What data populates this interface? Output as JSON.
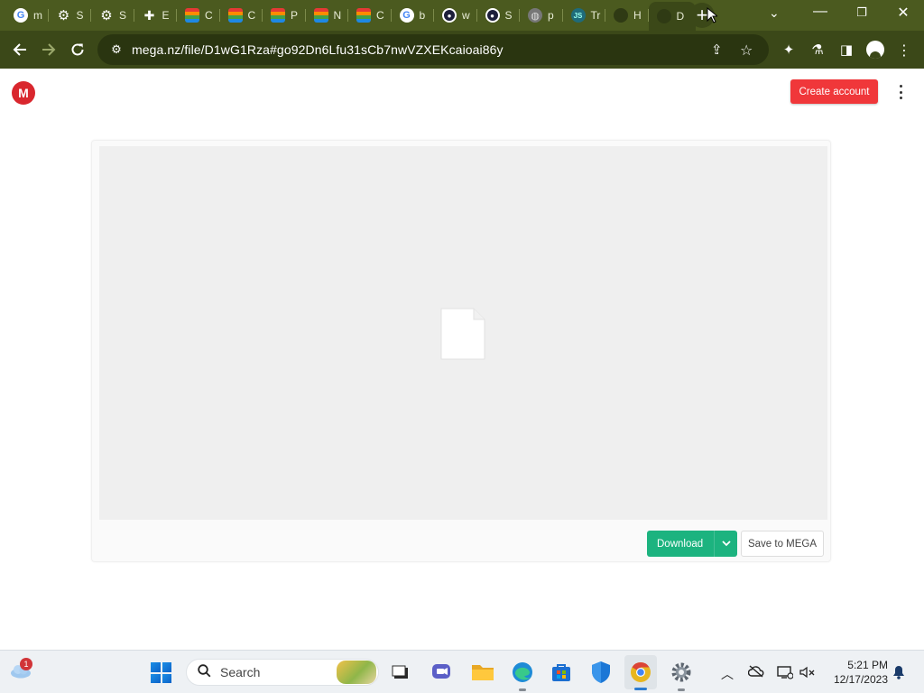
{
  "browser": {
    "tabs": [
      {
        "title": "m",
        "icon": "google-icon"
      },
      {
        "title": "S",
        "icon": "gear-icon"
      },
      {
        "title": "S",
        "icon": "gear-icon"
      },
      {
        "title": "E",
        "icon": "puzzle-icon"
      },
      {
        "title": "C",
        "icon": "rainbow-icon"
      },
      {
        "title": "C",
        "icon": "rainbow-icon"
      },
      {
        "title": "P",
        "icon": "rainbow-icon"
      },
      {
        "title": "N",
        "icon": "rainbow-icon"
      },
      {
        "title": "C",
        "icon": "rainbow-icon"
      },
      {
        "title": "b",
        "icon": "google-icon"
      },
      {
        "title": "w",
        "icon": "shield-icon"
      },
      {
        "title": "S",
        "icon": "shield-icon"
      },
      {
        "title": "p",
        "icon": "globe-icon"
      },
      {
        "title": "Tr",
        "icon": "teal-icon"
      },
      {
        "title": "H",
        "icon": "dark-icon"
      },
      {
        "title": "D",
        "icon": "dark-icon",
        "active": true
      }
    ],
    "new_tab_symbol": "+",
    "tab_close_symbol": "✕",
    "url": "mega.nz/file/D1wG1Rza#go92Dn6Lfu31sCb7nwVZXEKcaioai86y",
    "accent_color": "#3b4818"
  },
  "page": {
    "logo_letter": "M",
    "create_account_label": "Create account",
    "download_label": "Download",
    "save_label": "Save to MEGA",
    "brand_red": "#d9272e",
    "download_green": "#1cb37f"
  },
  "taskbar": {
    "notification_count": "1",
    "search_placeholder": "Search",
    "time": "5:21 PM",
    "date": "12/17/2023"
  }
}
